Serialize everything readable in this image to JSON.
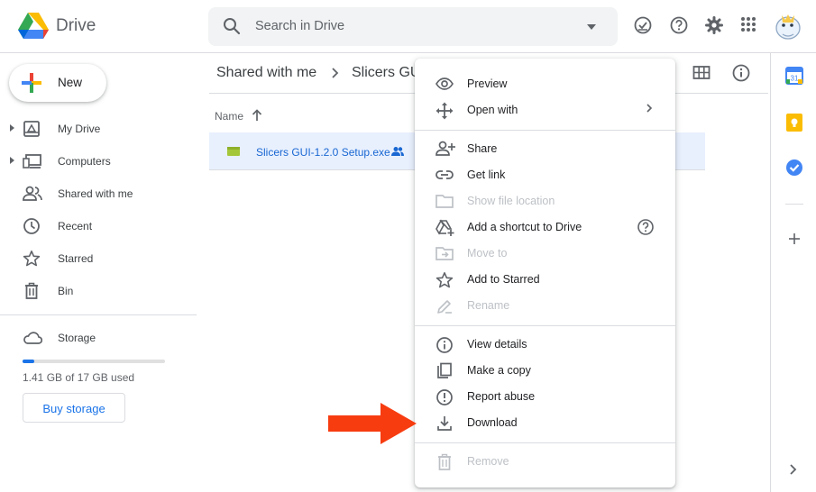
{
  "brand": "Drive",
  "search": {
    "placeholder": "Search in Drive"
  },
  "colors": {
    "accent": "#1a73e8",
    "arrow": "#f73c10",
    "selected_row": "#e8f0fe"
  },
  "top_icons": [
    "ready-for-offline-icon",
    "help-icon",
    "settings-icon",
    "apps-grid-icon",
    "account-avatar"
  ],
  "sidebar": {
    "new_label": "New",
    "items": [
      {
        "label": "My Drive",
        "icon": "my-drive-icon",
        "expandable": true
      },
      {
        "label": "Computers",
        "icon": "computers-icon",
        "expandable": true
      },
      {
        "label": "Shared with me",
        "icon": "shared-with-me-icon",
        "expandable": false
      },
      {
        "label": "Recent",
        "icon": "clock-icon",
        "expandable": false
      },
      {
        "label": "Starred",
        "icon": "star-icon",
        "expandable": false
      },
      {
        "label": "Bin",
        "icon": "bin-icon",
        "expandable": false
      }
    ],
    "storage_label": "Storage",
    "storage_used_text": "1.41 GB of 17 GB used",
    "storage_fraction": 0.083,
    "buy_label": "Buy storage"
  },
  "main": {
    "breadcrumb": {
      "root": "Shared with me",
      "current": "Slicers GU"
    },
    "column_name": "Name",
    "file": {
      "name": "Slicers GUI-1.2.0 Setup.exe",
      "shared": true
    }
  },
  "context_menu": {
    "groups": [
      [
        {
          "label": "Preview",
          "icon": "eye-icon",
          "disabled": false
        },
        {
          "label": "Open with",
          "icon": "move-arrows-icon",
          "disabled": false,
          "submenu": true
        }
      ],
      [
        {
          "label": "Share",
          "icon": "person-add-icon",
          "disabled": false
        },
        {
          "label": "Get link",
          "icon": "link-icon",
          "disabled": false
        },
        {
          "label": "Show file location",
          "icon": "folder-icon",
          "disabled": true
        },
        {
          "label": "Add a shortcut to Drive",
          "icon": "drive-shortcut-icon",
          "disabled": false,
          "help": true
        },
        {
          "label": "Move to",
          "icon": "move-to-folder-icon",
          "disabled": true
        },
        {
          "label": "Add to Starred",
          "icon": "star-icon",
          "disabled": false
        },
        {
          "label": "Rename",
          "icon": "pencil-icon",
          "disabled": true
        }
      ],
      [
        {
          "label": "View details",
          "icon": "info-icon",
          "disabled": false
        },
        {
          "label": "Make a copy",
          "icon": "copy-icon",
          "disabled": false
        },
        {
          "label": "Report abuse",
          "icon": "report-icon",
          "disabled": false
        },
        {
          "label": "Download",
          "icon": "download-icon",
          "disabled": false
        }
      ],
      [
        {
          "label": "Remove",
          "icon": "trash-icon",
          "disabled": true
        }
      ]
    ]
  }
}
